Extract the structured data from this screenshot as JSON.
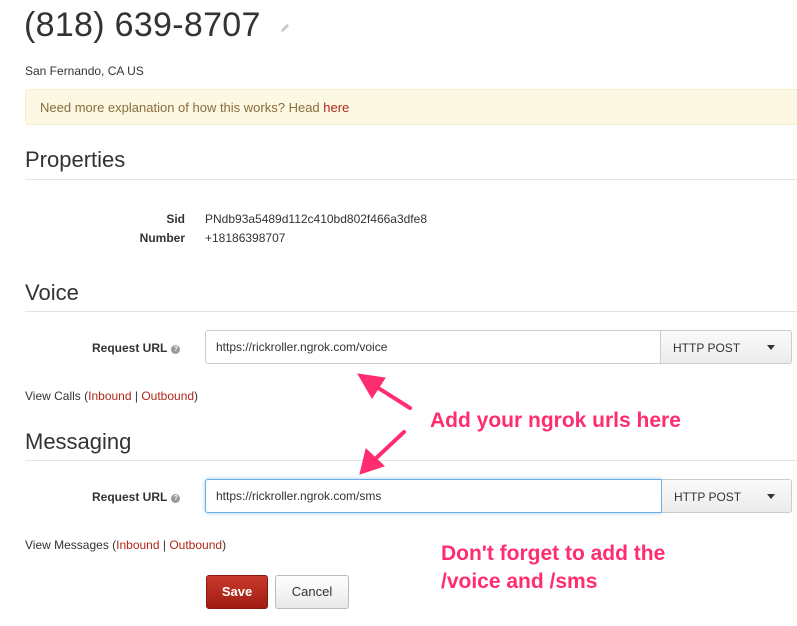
{
  "header": {
    "phone_number": "(818) 639-8707",
    "edit_icon": "pencil-icon",
    "location": "San Fernando, CA US"
  },
  "alert": {
    "text": "Need more explanation of how this works? Head ",
    "link": "here"
  },
  "properties": {
    "title": "Properties",
    "rows": [
      {
        "label": "Sid",
        "value": "PNdb93a5489d112c410bd802f466a3dfe8"
      },
      {
        "label": "Number",
        "value": "+18186398707"
      }
    ]
  },
  "voice": {
    "title": "Voice",
    "request_url_label": "Request URL",
    "request_url_value": "https://rickroller.ngrok.com/voice",
    "method": "HTTP POST",
    "view_prefix": "View Calls (",
    "inbound": "Inbound",
    "separator": " | ",
    "outbound": "Outbound",
    "view_suffix": ")"
  },
  "messaging": {
    "title": "Messaging",
    "request_url_label": "Request URL",
    "request_url_value": "https://rickroller.ngrok.com/sms",
    "method": "HTTP POST",
    "view_prefix": "View Messages (",
    "inbound": "Inbound",
    "separator": " | ",
    "outbound": "Outbound",
    "view_suffix": ")"
  },
  "annotations": {
    "ngrok_note": "Add your ngrok urls here",
    "forget_line1": "Don't forget to add the",
    "forget_line2": "/voice and /sms",
    "color": "#ff2d6f"
  },
  "actions": {
    "save": "Save",
    "cancel": "Cancel"
  },
  "colors": {
    "link": "#b0281a",
    "save_button": "#b5291d",
    "alert_background": "#fcf8e3"
  }
}
